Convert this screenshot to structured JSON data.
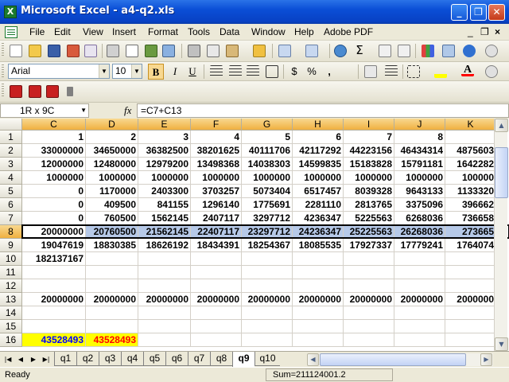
{
  "window": {
    "title": "Microsoft Excel - a4-q2.xls",
    "app_icon": "X"
  },
  "menu": {
    "items": [
      "File",
      "Edit",
      "View",
      "Insert",
      "Format",
      "Tools",
      "Data",
      "Window",
      "Help",
      "Adobe PDF"
    ],
    "mdi_min": "_",
    "mdi_restore": "❐",
    "mdi_close": "×"
  },
  "format_toolbar": {
    "font": "Arial",
    "size": "10",
    "bold": "B",
    "italic": "I",
    "underline": "U",
    "currency": "$",
    "percent": "%",
    "comma": ","
  },
  "standard_toolbar": {
    "sum_symbol": "Σ"
  },
  "formula_bar": {
    "name_box": "1R x 9C",
    "fx": "fx",
    "formula": "=C7+C13"
  },
  "grid": {
    "columns": [
      "C",
      "D",
      "E",
      "F",
      "G",
      "H",
      "I",
      "J",
      "K"
    ],
    "rows": [
      "1",
      "2",
      "3",
      "4",
      "5",
      "6",
      "7",
      "8",
      "9",
      "10",
      "11",
      "12",
      "13",
      "14",
      "15",
      "16"
    ],
    "data": [
      [
        "1",
        "2",
        "3",
        "4",
        "5",
        "6",
        "7",
        "8",
        ""
      ],
      [
        "33000000",
        "34650000",
        "36382500",
        "38201625",
        "40111706",
        "42117292",
        "44223156",
        "46434314",
        "4875603"
      ],
      [
        "12000000",
        "12480000",
        "12979200",
        "13498368",
        "14038303",
        "14599835",
        "15183828",
        "15791181",
        "1642282"
      ],
      [
        "1000000",
        "1000000",
        "1000000",
        "1000000",
        "1000000",
        "1000000",
        "1000000",
        "1000000",
        "100000"
      ],
      [
        "0",
        "1170000",
        "2403300",
        "3703257",
        "5073404",
        "6517457",
        "8039328",
        "9643133",
        "1133320"
      ],
      [
        "0",
        "409500",
        "841155",
        "1296140",
        "1775691",
        "2281110",
        "2813765",
        "3375096",
        "396662"
      ],
      [
        "0",
        "760500",
        "1562145",
        "2407117",
        "3297712",
        "4236347",
        "5225563",
        "6268036",
        "736658"
      ],
      [
        "20000000",
        "20760500",
        "21562145",
        "22407117",
        "23297712",
        "24236347",
        "25225563",
        "26268036",
        "273665"
      ],
      [
        "19047619",
        "18830385",
        "18626192",
        "18434391",
        "18254367",
        "18085535",
        "17927337",
        "17779241",
        "1764074"
      ],
      [
        "182137167",
        "",
        "",
        "",
        "",
        "",
        "",
        "",
        ""
      ],
      [
        "",
        "",
        "",
        "",
        "",
        "",
        "",
        "",
        ""
      ],
      [
        "",
        "",
        "",
        "",
        "",
        "",
        "",
        "",
        ""
      ],
      [
        "20000000",
        "20000000",
        "20000000",
        "20000000",
        "20000000",
        "20000000",
        "20000000",
        "20000000",
        "2000000"
      ],
      [
        "",
        "",
        "",
        "",
        "",
        "",
        "",
        "",
        ""
      ],
      [
        "",
        "",
        "",
        "",
        "",
        "",
        "",
        "",
        ""
      ],
      [
        "43528493",
        "43528493",
        "",
        "",
        "",
        "",
        "",
        "",
        ""
      ]
    ],
    "selected_row": "8",
    "highlight_colors": {
      "yellow_fill": "#ffff00",
      "blue_text": "#0000ff",
      "red_text": "#ff0000",
      "selection": "#b6c9e8"
    }
  },
  "sheet_tabs": {
    "tabs": [
      "q1",
      "q2",
      "q3",
      "q4",
      "q5",
      "q6",
      "q7",
      "q8",
      "q9",
      "q10"
    ],
    "active": "q9"
  },
  "status": {
    "ready": "Ready",
    "sum": "Sum=211124001.2"
  }
}
